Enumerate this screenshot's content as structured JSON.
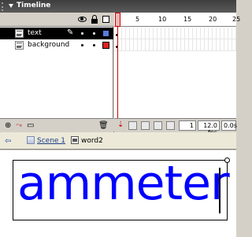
{
  "window": {
    "title": "Timeline"
  },
  "layers": [
    {
      "name": "text",
      "selected": true,
      "color": "#5a7ae0"
    },
    {
      "name": "background",
      "selected": false,
      "color": "#e02020"
    }
  ],
  "ruler": {
    "numbers": [
      "1",
      "5",
      "10",
      "15",
      "20",
      "25"
    ]
  },
  "status": {
    "frame": "1",
    "fps": "12.0 fps",
    "time": "0.0s"
  },
  "breadcrumb": {
    "scene": "Scene 1",
    "symbol": "word2"
  },
  "stage": {
    "text": "ammeter",
    "text_color": "#0000ff"
  }
}
